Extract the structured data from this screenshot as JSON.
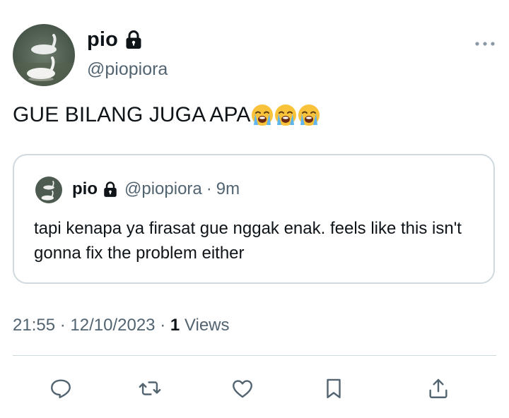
{
  "tweet": {
    "display_name": "pio",
    "handle": "@piopiora",
    "text": "GUE BILANG JUGA APA",
    "emojis": [
      "loudly-crying-face",
      "loudly-crying-face",
      "loudly-crying-face"
    ],
    "time": "21:55",
    "date": "12/10/2023",
    "views_count": "1",
    "views_label": "Views",
    "separator": "·"
  },
  "quoted": {
    "display_name": "pio",
    "handle": "@piopiora",
    "separator": "·",
    "time": "9m",
    "text": "tapi kenapa ya firasat gue nggak enak. feels like this isn't gonna fix the problem either"
  },
  "icons": {
    "lock": "lock-icon",
    "more": "more-icon",
    "reply": "reply-icon",
    "retweet": "retweet-icon",
    "like": "heart-icon",
    "bookmark": "bookmark-icon",
    "share": "share-icon"
  },
  "colors": {
    "text_primary": "#0f1419",
    "text_secondary": "#536471",
    "border": "#cfd9de"
  }
}
